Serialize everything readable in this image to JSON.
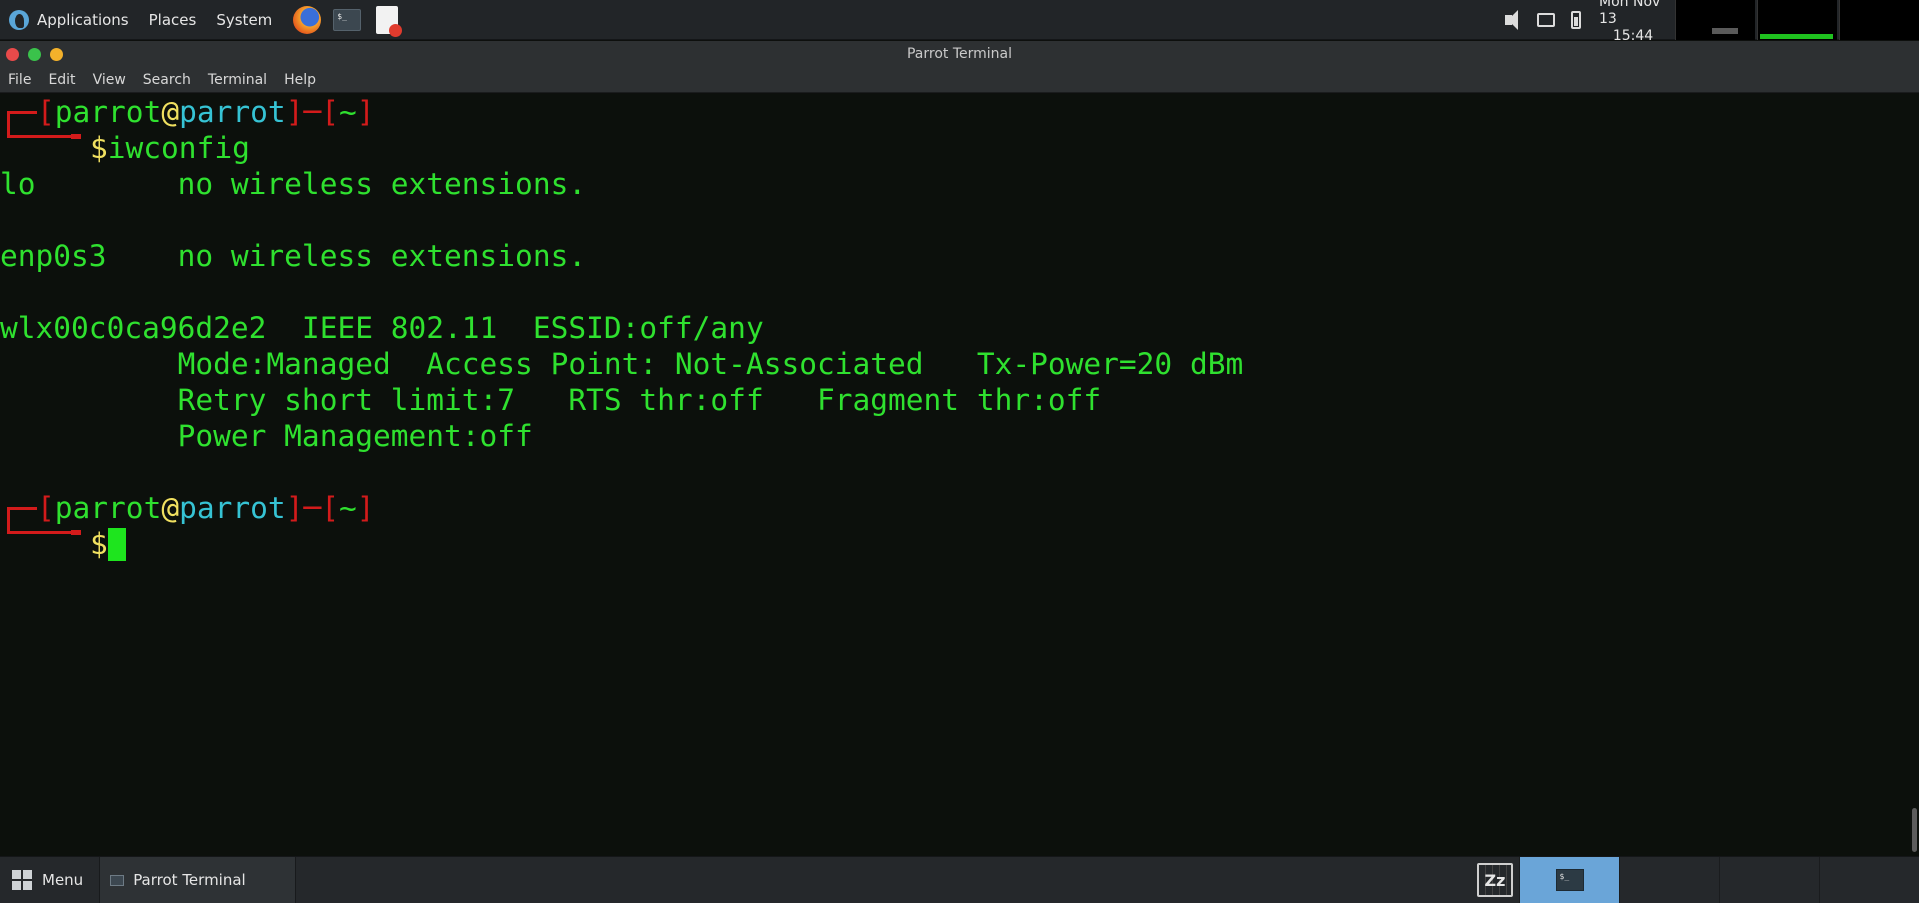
{
  "top_panel": {
    "menus": [
      "Applications",
      "Places",
      "System"
    ],
    "launchers": [
      "firefox-icon",
      "terminal-icon",
      "text-editor-icon"
    ],
    "clock": {
      "date": "Mon Nov 13",
      "time": "15:44"
    },
    "tray_icons": [
      "speaker-icon",
      "display-icon",
      "battery-icon"
    ]
  },
  "window": {
    "title": "Parrot Terminal",
    "menu": [
      "File",
      "Edit",
      "View",
      "Search",
      "Terminal",
      "Help"
    ]
  },
  "terminal": {
    "prompt": {
      "user": "parrot",
      "at": "@",
      "host": "parrot",
      "dir": "~",
      "symbol": "$"
    },
    "command": "iwconfig",
    "output": [
      "lo        no wireless extensions.",
      "",
      "enp0s3    no wireless extensions.",
      "",
      "wlx00c0ca96d2e2  IEEE 802.11  ESSID:off/any",
      "          Mode:Managed  Access Point: Not-Associated   Tx-Power=20 dBm",
      "          Retry short limit:7   RTS thr:off   Fragment thr:off",
      "          Power Management:off"
    ],
    "colors": {
      "text": "#2fe12f",
      "bracket": "#d31b1b",
      "at": "#f0e060",
      "host": "#36c3d4",
      "cursor": "#1ee51e"
    }
  },
  "bottom_panel": {
    "menu_label": "Menu",
    "task_label": "Parrot Terminal",
    "workspaces": 4,
    "active_workspace": 1
  }
}
